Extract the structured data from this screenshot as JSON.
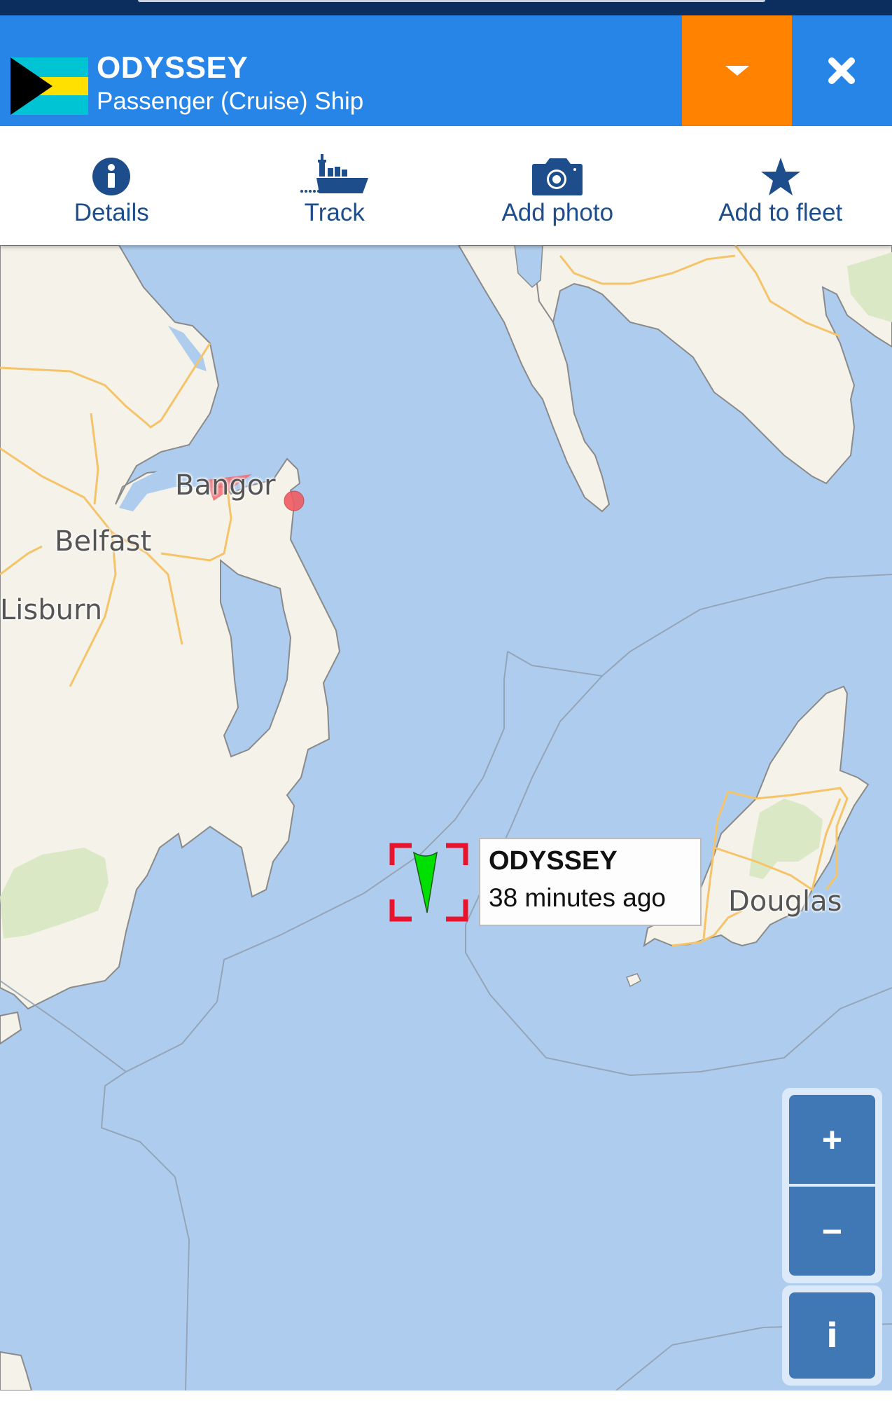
{
  "vessel": {
    "name": "ODYSSEY",
    "type": "Passenger (Cruise) Ship",
    "flag": "Bahamas",
    "flag_colors": {
      "aqua": "#00c3d4",
      "gold": "#ffe000",
      "black": "#000000"
    }
  },
  "header": {
    "dropdown_icon": "caret-down-icon",
    "close_icon": "close-icon",
    "colors": {
      "header_bg": "#2785e8",
      "dropdown_bg": "#ff8200"
    }
  },
  "toolbar": {
    "items": [
      {
        "label": "Details",
        "icon": "info-circle-icon"
      },
      {
        "label": "Track",
        "icon": "ship-track-icon"
      },
      {
        "label": "Add photo",
        "icon": "camera-icon"
      },
      {
        "label": "Add to fleet",
        "icon": "star-icon"
      }
    ],
    "color": "#1e4d8c"
  },
  "map": {
    "places": [
      "Bangor",
      "Belfast",
      "Lisburn",
      "Douglas"
    ],
    "selected_vessel_label": {
      "name": "ODYSSEY",
      "last_seen": "38 minutes ago"
    },
    "colors": {
      "sea": "#aecdee",
      "land": "#f5f2e9",
      "road": "#f5c46a",
      "park": "#dbe8c6",
      "marker": "#00e000",
      "target": "#e8132c"
    },
    "controls": {
      "zoom_in": "+",
      "zoom_out": "−",
      "info": "i"
    }
  }
}
